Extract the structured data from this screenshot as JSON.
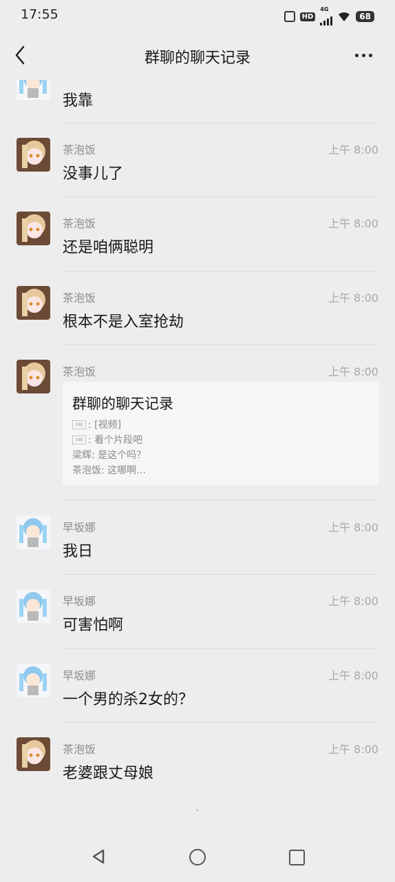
{
  "status_bar": {
    "time": "17:55",
    "network": "4G",
    "hd": "HD",
    "battery": "68"
  },
  "header": {
    "title": "群聊的聊天记录"
  },
  "messages": [
    {
      "text": "我靠",
      "avatar": "blue-hair-avatar"
    },
    {
      "sender": "茶泡饭",
      "time": "上午 8:00",
      "text": "没事儿了",
      "avatar": "blonde-avatar"
    },
    {
      "sender": "茶泡饭",
      "time": "上午 8:00",
      "text": "还是咱俩聪明",
      "avatar": "blonde-avatar"
    },
    {
      "sender": "茶泡饭",
      "time": "上午 8:00",
      "text": "根本不是入室抢劫",
      "avatar": "blonde-avatar"
    },
    {
      "sender": "茶泡饭",
      "time": "上午 8:00",
      "avatar": "blonde-avatar"
    },
    {
      "sender": "早坂娜",
      "time": "上午 8:00",
      "text": "我日",
      "avatar": "blue-hair-avatar"
    },
    {
      "sender": "早坂娜",
      "time": "上午 8:00",
      "text": "可害怕啊",
      "avatar": "blue-hair-avatar"
    },
    {
      "sender": "早坂娜",
      "time": "上午 8:00",
      "text": "一个男的杀2女的？",
      "avatar": "blue-hair-avatar"
    },
    {
      "sender": "茶泡饭",
      "time": "上午 8:00",
      "text": "老婆跟丈母娘",
      "avatar": "blonde-avatar"
    }
  ],
  "forward_card": {
    "title": "群聊的聊天记录",
    "obj_label": "OBJ",
    "lines": [
      ": [视频]",
      ": 看个片段吧",
      "梁辉: 是这个吗？",
      "茶泡饭: 这哪啊…"
    ]
  },
  "colors": {
    "background": "#ededed",
    "card": "#f6f6f6",
    "meta_text": "#a8a8a8"
  }
}
